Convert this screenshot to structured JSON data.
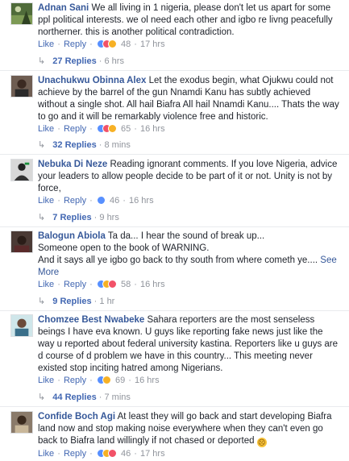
{
  "actions": {
    "like": "Like",
    "reply": "Reply",
    "sep": "·"
  },
  "comments": [
    {
      "author": "Adnan Sani",
      "text": "We all living in 1 nigeria, please don't let us apart for some ppl political interests. we ol need each other and igbo re livng peacefully northerner. this is another political contradiction.",
      "reactions": [
        "like",
        "love",
        "haha"
      ],
      "reaction_count": "48",
      "time": "17 hrs",
      "replies_label": "27 Replies",
      "replies_time": "6 hrs"
    },
    {
      "author": "Unachukwu Obinna Alex",
      "text": "Let the exodus begin, what Ojukwu could not achieve by the barrel of the gun Nnamdi Kanu has subtly achieved without a single shot. All hail Biafra All hail Nnamdi Kanu.... Thats the way to go and it will be remarkably violence free and historic.",
      "reactions": [
        "like",
        "love",
        "haha"
      ],
      "reaction_count": "65",
      "time": "16 hrs",
      "replies_label": "32 Replies",
      "replies_time": "8 mins"
    },
    {
      "author": "Nebuka Di Neze",
      "text": "Reading ignorant comments. If you love Nigeria, advice your leaders to allow people decide to be part of it or not. Unity is not by force,",
      "reactions": [
        "like"
      ],
      "reaction_count": "46",
      "time": "16 hrs",
      "replies_label": "7 Replies",
      "replies_time": "9 hrs"
    },
    {
      "author": "Balogun Abiola",
      "text": "Ta da... I hear the sound of break up...\nSomeone open to the book of WARNING.\nAnd it says all ye igbo go back to thy south from where cometh ye....",
      "see_more": "See More",
      "reactions": [
        "like",
        "haha",
        "love"
      ],
      "reaction_count": "58",
      "time": "16 hrs",
      "replies_label": "9 Replies",
      "replies_time": "1 hr"
    },
    {
      "author": "Chomzee Best Nwabeke",
      "text": "Sahara reporters are the most senseless beings I have eva known. U guys like reporting fake news just like the way u reported about federal university kastina. Reporters like u guys are d course of d problem we have in this country... This meeting never existed stop inciting hatred among Nigerians.",
      "reactions": [
        "like",
        "haha"
      ],
      "reaction_count": "69",
      "time": "16 hrs",
      "replies_label": "44 Replies",
      "replies_time": "7 mins"
    },
    {
      "author": "Confide Boch Agi",
      "text": "At least they will go back and start developing Biafra land now and stop making noise everywhere when they can't even go back to Biafra land willingly if not chased or deported",
      "emoji_name": "disappointed-face-icon",
      "reactions": [
        "like",
        "haha",
        "love"
      ],
      "reaction_count": "46",
      "time": "17 hrs"
    }
  ]
}
